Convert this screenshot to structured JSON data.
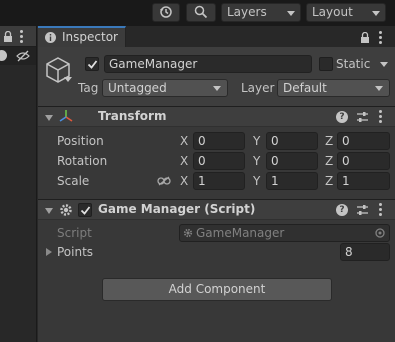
{
  "toolbar": {
    "history_icon": "history-icon",
    "search_icon": "search-icon",
    "layers_label": "Layers",
    "layout_label": "Layout"
  },
  "inspector": {
    "tab_label": "Inspector",
    "object": {
      "active": true,
      "name": "GameManager",
      "static_label": "Static",
      "static_checked": false,
      "tag_label": "Tag",
      "tag_value": "Untagged",
      "layer_label": "Layer",
      "layer_value": "Default"
    },
    "transform": {
      "title": "Transform",
      "position_label": "Position",
      "rotation_label": "Rotation",
      "scale_label": "Scale",
      "axis_x": "X",
      "axis_y": "Y",
      "axis_z": "Z",
      "position": {
        "x": "0",
        "y": "0",
        "z": "0"
      },
      "rotation": {
        "x": "0",
        "y": "0",
        "z": "0"
      },
      "scale": {
        "x": "1",
        "y": "1",
        "z": "1"
      }
    },
    "script_component": {
      "title": "Game Manager (Script)",
      "enabled": true,
      "script_label": "Script",
      "script_value": "GameManager",
      "points_label": "Points",
      "points_value": "8"
    },
    "add_component_label": "Add Component"
  },
  "colors": {
    "tab_accent": "#3a79bb",
    "panel_bg": "#383838",
    "field_bg": "#2a2a2a"
  }
}
